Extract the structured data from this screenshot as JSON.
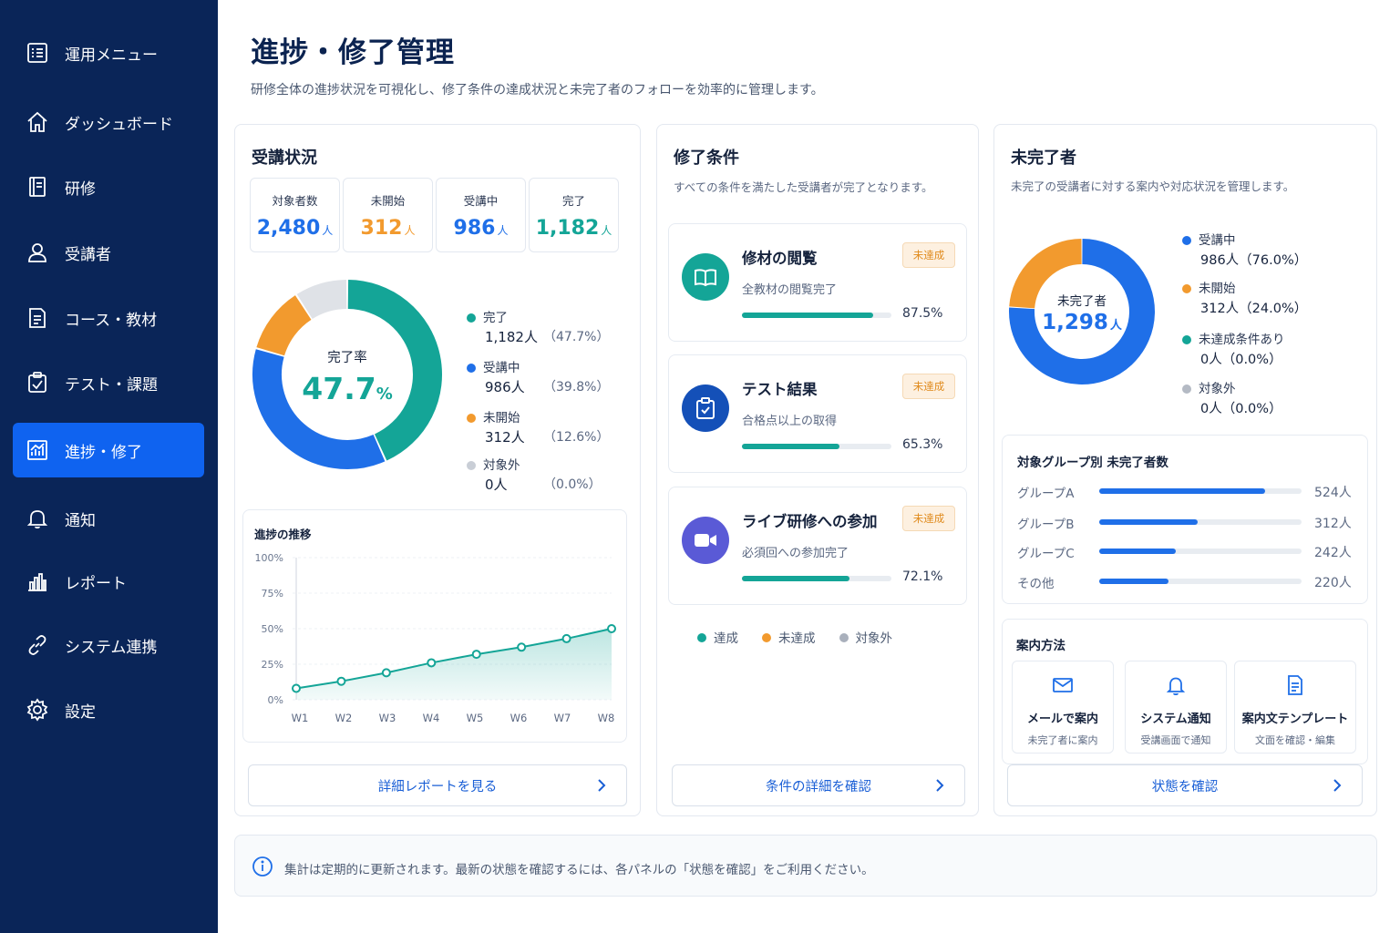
{
  "sidebar": {
    "items": [
      {
        "label": "運用メニュー",
        "icon": "menu-grid-icon"
      },
      {
        "label": "ダッシュボード",
        "icon": "home-icon"
      },
      {
        "label": "研修",
        "icon": "book-icon"
      },
      {
        "label": "受講者",
        "icon": "user-icon"
      },
      {
        "label": "コース・教材",
        "icon": "document-icon"
      },
      {
        "label": "テスト・課題",
        "icon": "clipboard-check-icon"
      },
      {
        "label": "進捗・修了",
        "icon": "progress-chart-icon",
        "active": true
      },
      {
        "label": "通知",
        "icon": "bell-icon"
      },
      {
        "label": "レポート",
        "icon": "bar-chart-icon"
      },
      {
        "label": "システム連携",
        "icon": "link-icon"
      },
      {
        "label": "設定",
        "icon": "gear-icon"
      }
    ]
  },
  "header": {
    "title": "進捗・修了管理",
    "description": "研修全体の進捗状況を可視化し、修了条件の達成状況と未完了者のフォローを効率的に管理します。"
  },
  "attendance": {
    "title": "受講状況",
    "unit": "人",
    "stats": [
      {
        "label": "対象者数",
        "value": "2,480",
        "color": "#1f6fe8"
      },
      {
        "label": "未開始",
        "value": "312",
        "color": "#f29a2e"
      },
      {
        "label": "受講中",
        "value": "986",
        "color": "#1f6fe8"
      },
      {
        "label": "完了",
        "value": "1,182",
        "color": "#14a597"
      }
    ],
    "donut": {
      "center_label": "完了率",
      "center_value": "47.7",
      "center_unit": "%",
      "legend": [
        {
          "label": "完了",
          "count": "1,182人",
          "pct": "（47.7%）",
          "value": 47.7,
          "color": "#14a597"
        },
        {
          "label": "受講中",
          "count": "986人",
          "pct": "（39.8%）",
          "value": 39.8,
          "color": "#1f6fe8"
        },
        {
          "label": "未開始",
          "count": "312人",
          "pct": "（12.6%）",
          "value": 12.6,
          "color": "#f29a2e"
        },
        {
          "label": "対象外",
          "count": "0人",
          "pct": "（0.0%）",
          "value": 0,
          "color": "#c9ced6"
        }
      ]
    },
    "trend_title": "進捗の推移",
    "button": "詳細レポートを見る"
  },
  "chart_data": {
    "type": "area",
    "title": "進捗の推移",
    "x": [
      "W1",
      "W2",
      "W3",
      "W4",
      "W5",
      "W6",
      "W7",
      "W8"
    ],
    "values": [
      8,
      13,
      19,
      26,
      32,
      37,
      43,
      50
    ],
    "yticks": [
      "100%",
      "75%",
      "50%",
      "25%",
      "0%"
    ],
    "ylim": [
      0,
      100
    ],
    "color": "#14a597"
  },
  "conditions": {
    "title": "修了条件",
    "subtitle": "すべての条件を満たした受講者が完了となります。",
    "items": [
      {
        "title": "修材の閲覧",
        "desc": "全教材の閲覧完了",
        "badge": "未達成",
        "pct": "87.5%",
        "value": 87.5,
        "icon": "open-book-icon",
        "icon_bg": "#14a597"
      },
      {
        "title": "テスト結果",
        "desc": "合格点以上の取得",
        "badge": "未達成",
        "pct": "65.3%",
        "value": 65.3,
        "icon": "clipboard-check-icon",
        "icon_bg": "#1450b8"
      },
      {
        "title": "ライブ研修への参加",
        "desc": "必須回への参加完了",
        "badge": "未達成",
        "pct": "72.1%",
        "value": 72.1,
        "icon": "video-camera-icon",
        "icon_bg": "#5a5ad6"
      }
    ],
    "legend": [
      {
        "label": "達成",
        "color": "#14a597"
      },
      {
        "label": "未達成",
        "color": "#f29a2e"
      },
      {
        "label": "対象外",
        "color": "#a9b0bc"
      }
    ],
    "button": "条件の詳細を確認"
  },
  "incomplete": {
    "title": "未完了者",
    "subtitle": "未完了の受講者に対する案内や対応状況を管理します。",
    "donut": {
      "center_label": "未完了者",
      "center_value": "1,298",
      "center_unit": "人",
      "legend": [
        {
          "label": "受講中",
          "detail": "986人（76.0%）",
          "value": 76.0,
          "color": "#1f6fe8"
        },
        {
          "label": "未開始",
          "detail": "312人（24.0%）",
          "value": 24.0,
          "color": "#f29a2e"
        },
        {
          "label": "未達成条件あり",
          "detail": "0人（0.0%）",
          "value": 0,
          "color": "#14a597"
        },
        {
          "label": "対象外",
          "detail": "0人（0.0%）",
          "value": 0,
          "color": "#b4bac4"
        }
      ]
    },
    "groups_title": "対象グループ別 未完了者数",
    "groups": [
      {
        "name": "グループA",
        "count": "524人",
        "value": 524
      },
      {
        "name": "グループB",
        "count": "312人",
        "value": 312
      },
      {
        "name": "グループC",
        "count": "242人",
        "value": 242
      },
      {
        "name": "その他",
        "count": "220人",
        "value": 220
      }
    ],
    "methods_title": "案内方法",
    "methods": [
      {
        "title": "メールで案内",
        "sub": "未完了者に案内",
        "icon": "mail-icon"
      },
      {
        "title": "システム通知",
        "sub": "受講画面で通知",
        "icon": "bell-icon"
      },
      {
        "title": "案内文テンプレート",
        "sub": "文面を確認・編集",
        "icon": "document-icon"
      }
    ],
    "button": "状態を確認"
  },
  "footer": {
    "info": "集計は定期的に更新されます。最新の状態を確認するには、各パネルの「状態を確認」をご利用ください。"
  }
}
